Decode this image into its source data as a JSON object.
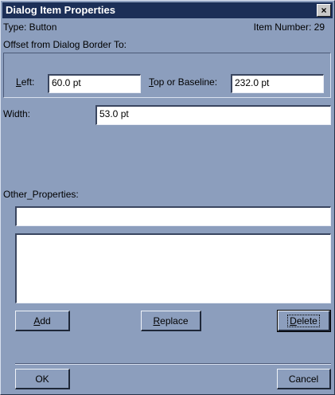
{
  "dialog": {
    "title": "Dialog Item Properties",
    "close_symbol": "×"
  },
  "info": {
    "type_text": "Type: Button",
    "item_number_text": "Item Number: 29"
  },
  "offset": {
    "heading": "Offset from Dialog Border To:",
    "left_label_mnemonic": "L",
    "left_label_rest": "eft:",
    "left_value": "60.0 pt",
    "top_label_mnemonic": "T",
    "top_label_rest": "op or Baseline:",
    "top_value": "232.0 pt"
  },
  "width": {
    "label": "Width:",
    "value": "53.0 pt"
  },
  "other": {
    "label": "Other_Properties:",
    "input_value": "",
    "list_items": []
  },
  "buttons": {
    "add_mnemonic": "A",
    "add_rest": "dd",
    "replace_mnemonic": "R",
    "replace_rest": "eplace",
    "delete_mnemonic": "D",
    "delete_rest": "elete",
    "ok": "OK",
    "cancel": "Cancel"
  }
}
